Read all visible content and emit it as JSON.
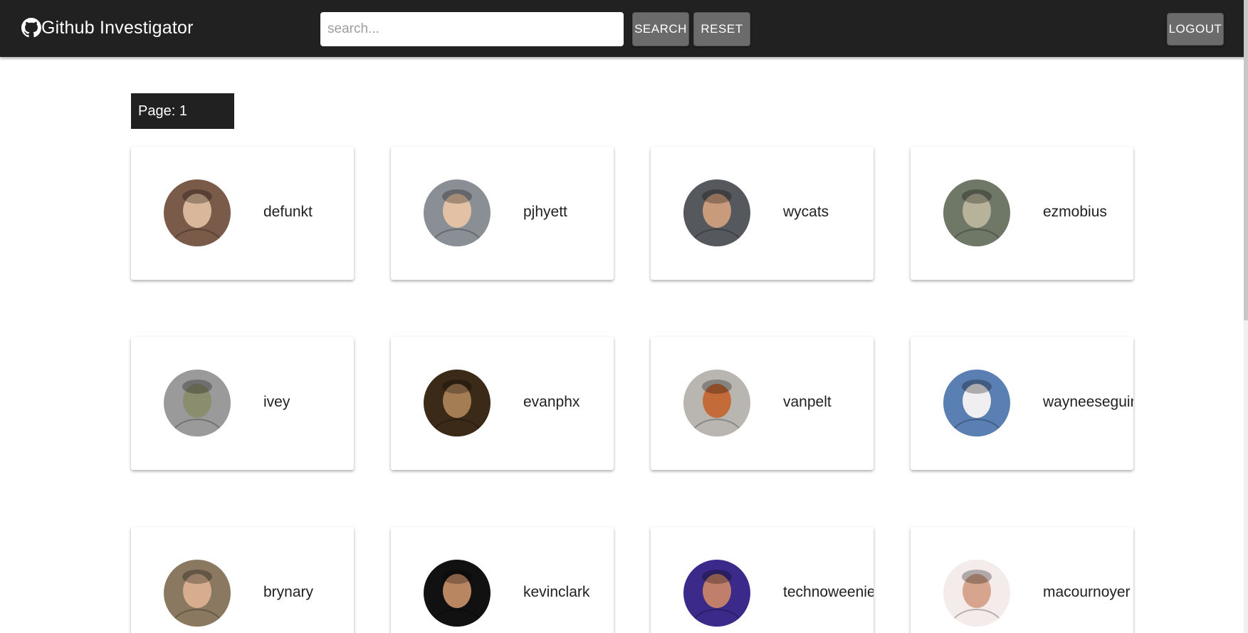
{
  "app": {
    "title": "Github Investigator",
    "logo_icon": "github-octocat-icon"
  },
  "search": {
    "placeholder": "search...",
    "value": ""
  },
  "buttons": {
    "search": "SEARCH",
    "reset": "RESET",
    "logout": "LOGOUT"
  },
  "page": {
    "label": "Page: 1"
  },
  "users": [
    {
      "login": "defunkt",
      "avatar_bg": "#7a5a48",
      "avatar_fg": "#d9b79a"
    },
    {
      "login": "pjhyett",
      "avatar_bg": "#8a8f96",
      "avatar_fg": "#e2c1a4"
    },
    {
      "login": "wycats",
      "avatar_bg": "#55585c",
      "avatar_fg": "#c99b7d"
    },
    {
      "login": "ezmobius",
      "avatar_bg": "#6f7766",
      "avatar_fg": "#b7b29a"
    },
    {
      "login": "ivey",
      "avatar_bg": "#9a9a9a",
      "avatar_fg": "#8b8e6e"
    },
    {
      "login": "evanphx",
      "avatar_bg": "#3b2a18",
      "avatar_fg": "#a57d55"
    },
    {
      "login": "vanpelt",
      "avatar_bg": "#b9b6b2",
      "avatar_fg": "#c46b3a"
    },
    {
      "login": "wayneeseguin",
      "avatar_bg": "#5a7fb2",
      "avatar_fg": "#f0eef0"
    },
    {
      "login": "brynary",
      "avatar_bg": "#8a7860",
      "avatar_fg": "#d6ad8e"
    },
    {
      "login": "kevinclark",
      "avatar_bg": "#111111",
      "avatar_fg": "#b98662"
    },
    {
      "login": "technoweenie",
      "avatar_bg": "#3b2a8a",
      "avatar_fg": "#c07f6a"
    },
    {
      "login": "macournoyer",
      "avatar_bg": "#f3ecea",
      "avatar_fg": "#d7a58d"
    }
  ]
}
